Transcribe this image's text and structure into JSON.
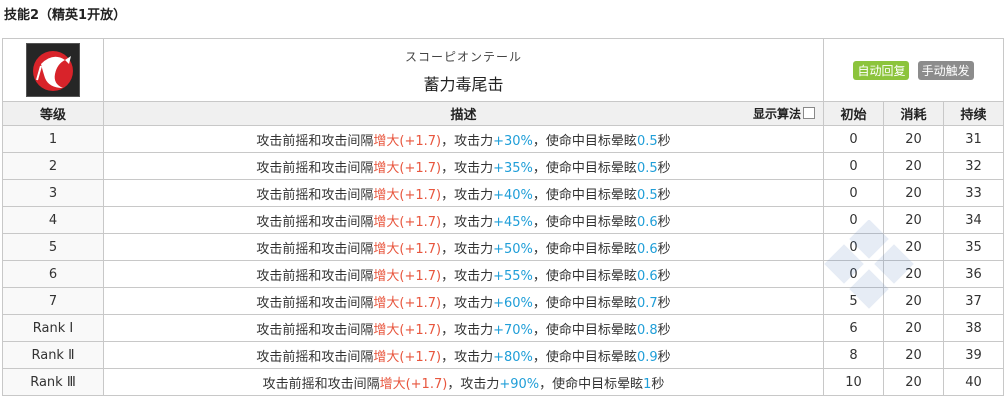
{
  "section_title": "技能2（精英1开放）",
  "skill": {
    "icon": "scorpion-tail-skill-icon",
    "subname": "スコーピオンテール",
    "name": "蓄力毒尾击",
    "tags": [
      {
        "label": "自动回复",
        "color": "#8cc43c"
      },
      {
        "label": "手动触发",
        "color": "#8c8c8c"
      }
    ]
  },
  "columns": {
    "level": "等级",
    "description": "描述",
    "formula_toggle": "显示算法",
    "initial": "初始",
    "cost": "消耗",
    "duration": "持续"
  },
  "description_parts": {
    "prefix": "攻击前摇和攻击间隔",
    "increase": "增大",
    "interval_value": "(+1.7)",
    "atk_text": "，攻击力",
    "stun_text": "，使命中目标晕眩",
    "unit": "秒"
  },
  "rows": [
    {
      "level": "1",
      "atk": "+30%",
      "stun": "0.5",
      "initial": "0",
      "cost": "20",
      "duration": "31"
    },
    {
      "level": "2",
      "atk": "+35%",
      "stun": "0.5",
      "initial": "0",
      "cost": "20",
      "duration": "32"
    },
    {
      "level": "3",
      "atk": "+40%",
      "stun": "0.5",
      "initial": "0",
      "cost": "20",
      "duration": "33"
    },
    {
      "level": "4",
      "atk": "+45%",
      "stun": "0.6",
      "initial": "0",
      "cost": "20",
      "duration": "34"
    },
    {
      "level": "5",
      "atk": "+50%",
      "stun": "0.6",
      "initial": "0",
      "cost": "20",
      "duration": "35"
    },
    {
      "level": "6",
      "atk": "+55%",
      "stun": "0.6",
      "initial": "0",
      "cost": "20",
      "duration": "36"
    },
    {
      "level": "7",
      "atk": "+60%",
      "stun": "0.7",
      "initial": "5",
      "cost": "20",
      "duration": "37"
    },
    {
      "level": "Rank Ⅰ",
      "atk": "+70%",
      "stun": "0.8",
      "initial": "6",
      "cost": "20",
      "duration": "38"
    },
    {
      "level": "Rank Ⅱ",
      "atk": "+80%",
      "stun": "0.9",
      "initial": "8",
      "cost": "20",
      "duration": "39"
    },
    {
      "level": "Rank Ⅲ",
      "atk": "+90%",
      "stun": "1",
      "initial": "10",
      "cost": "20",
      "duration": "40"
    }
  ]
}
